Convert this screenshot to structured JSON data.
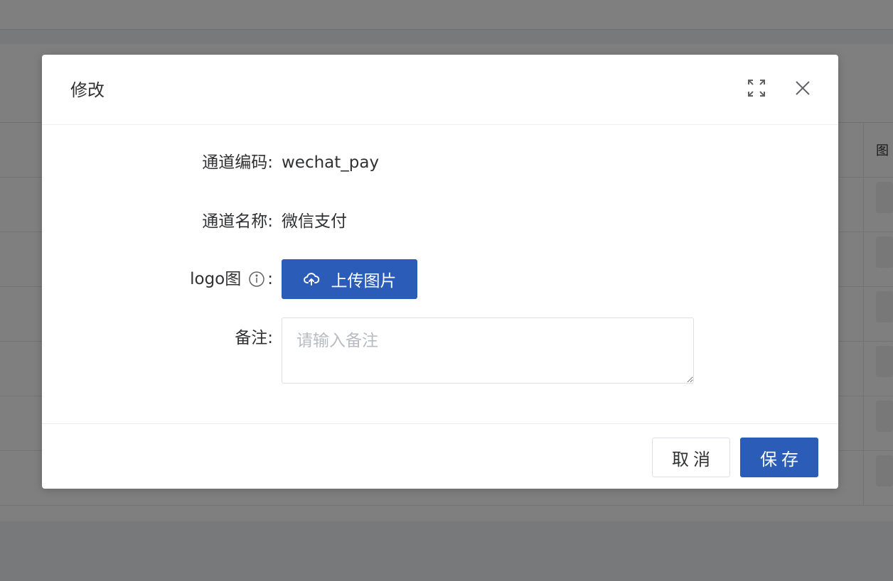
{
  "background": {
    "table_header_partial": "图"
  },
  "dialog": {
    "title": "修改",
    "fullscreen_icon": "fullscreen-icon",
    "close_icon": "close-icon",
    "fields": {
      "channel_code": {
        "label": "通道编码:",
        "value": "wechat_pay"
      },
      "channel_name": {
        "label": "通道名称:",
        "value": "微信支付"
      },
      "logo": {
        "label": "logo图",
        "label_suffix": ":",
        "info_icon": "info-icon",
        "upload_label": "上传图片",
        "upload_icon": "cloud-upload-icon"
      },
      "remark": {
        "label": "备注:",
        "placeholder": "请输入备注",
        "value": ""
      }
    },
    "footer": {
      "cancel_label": "取消",
      "save_label": "保存"
    }
  },
  "colors": {
    "primary": "#2a5cb8",
    "mask": "rgba(0,0,0,0.5)"
  }
}
